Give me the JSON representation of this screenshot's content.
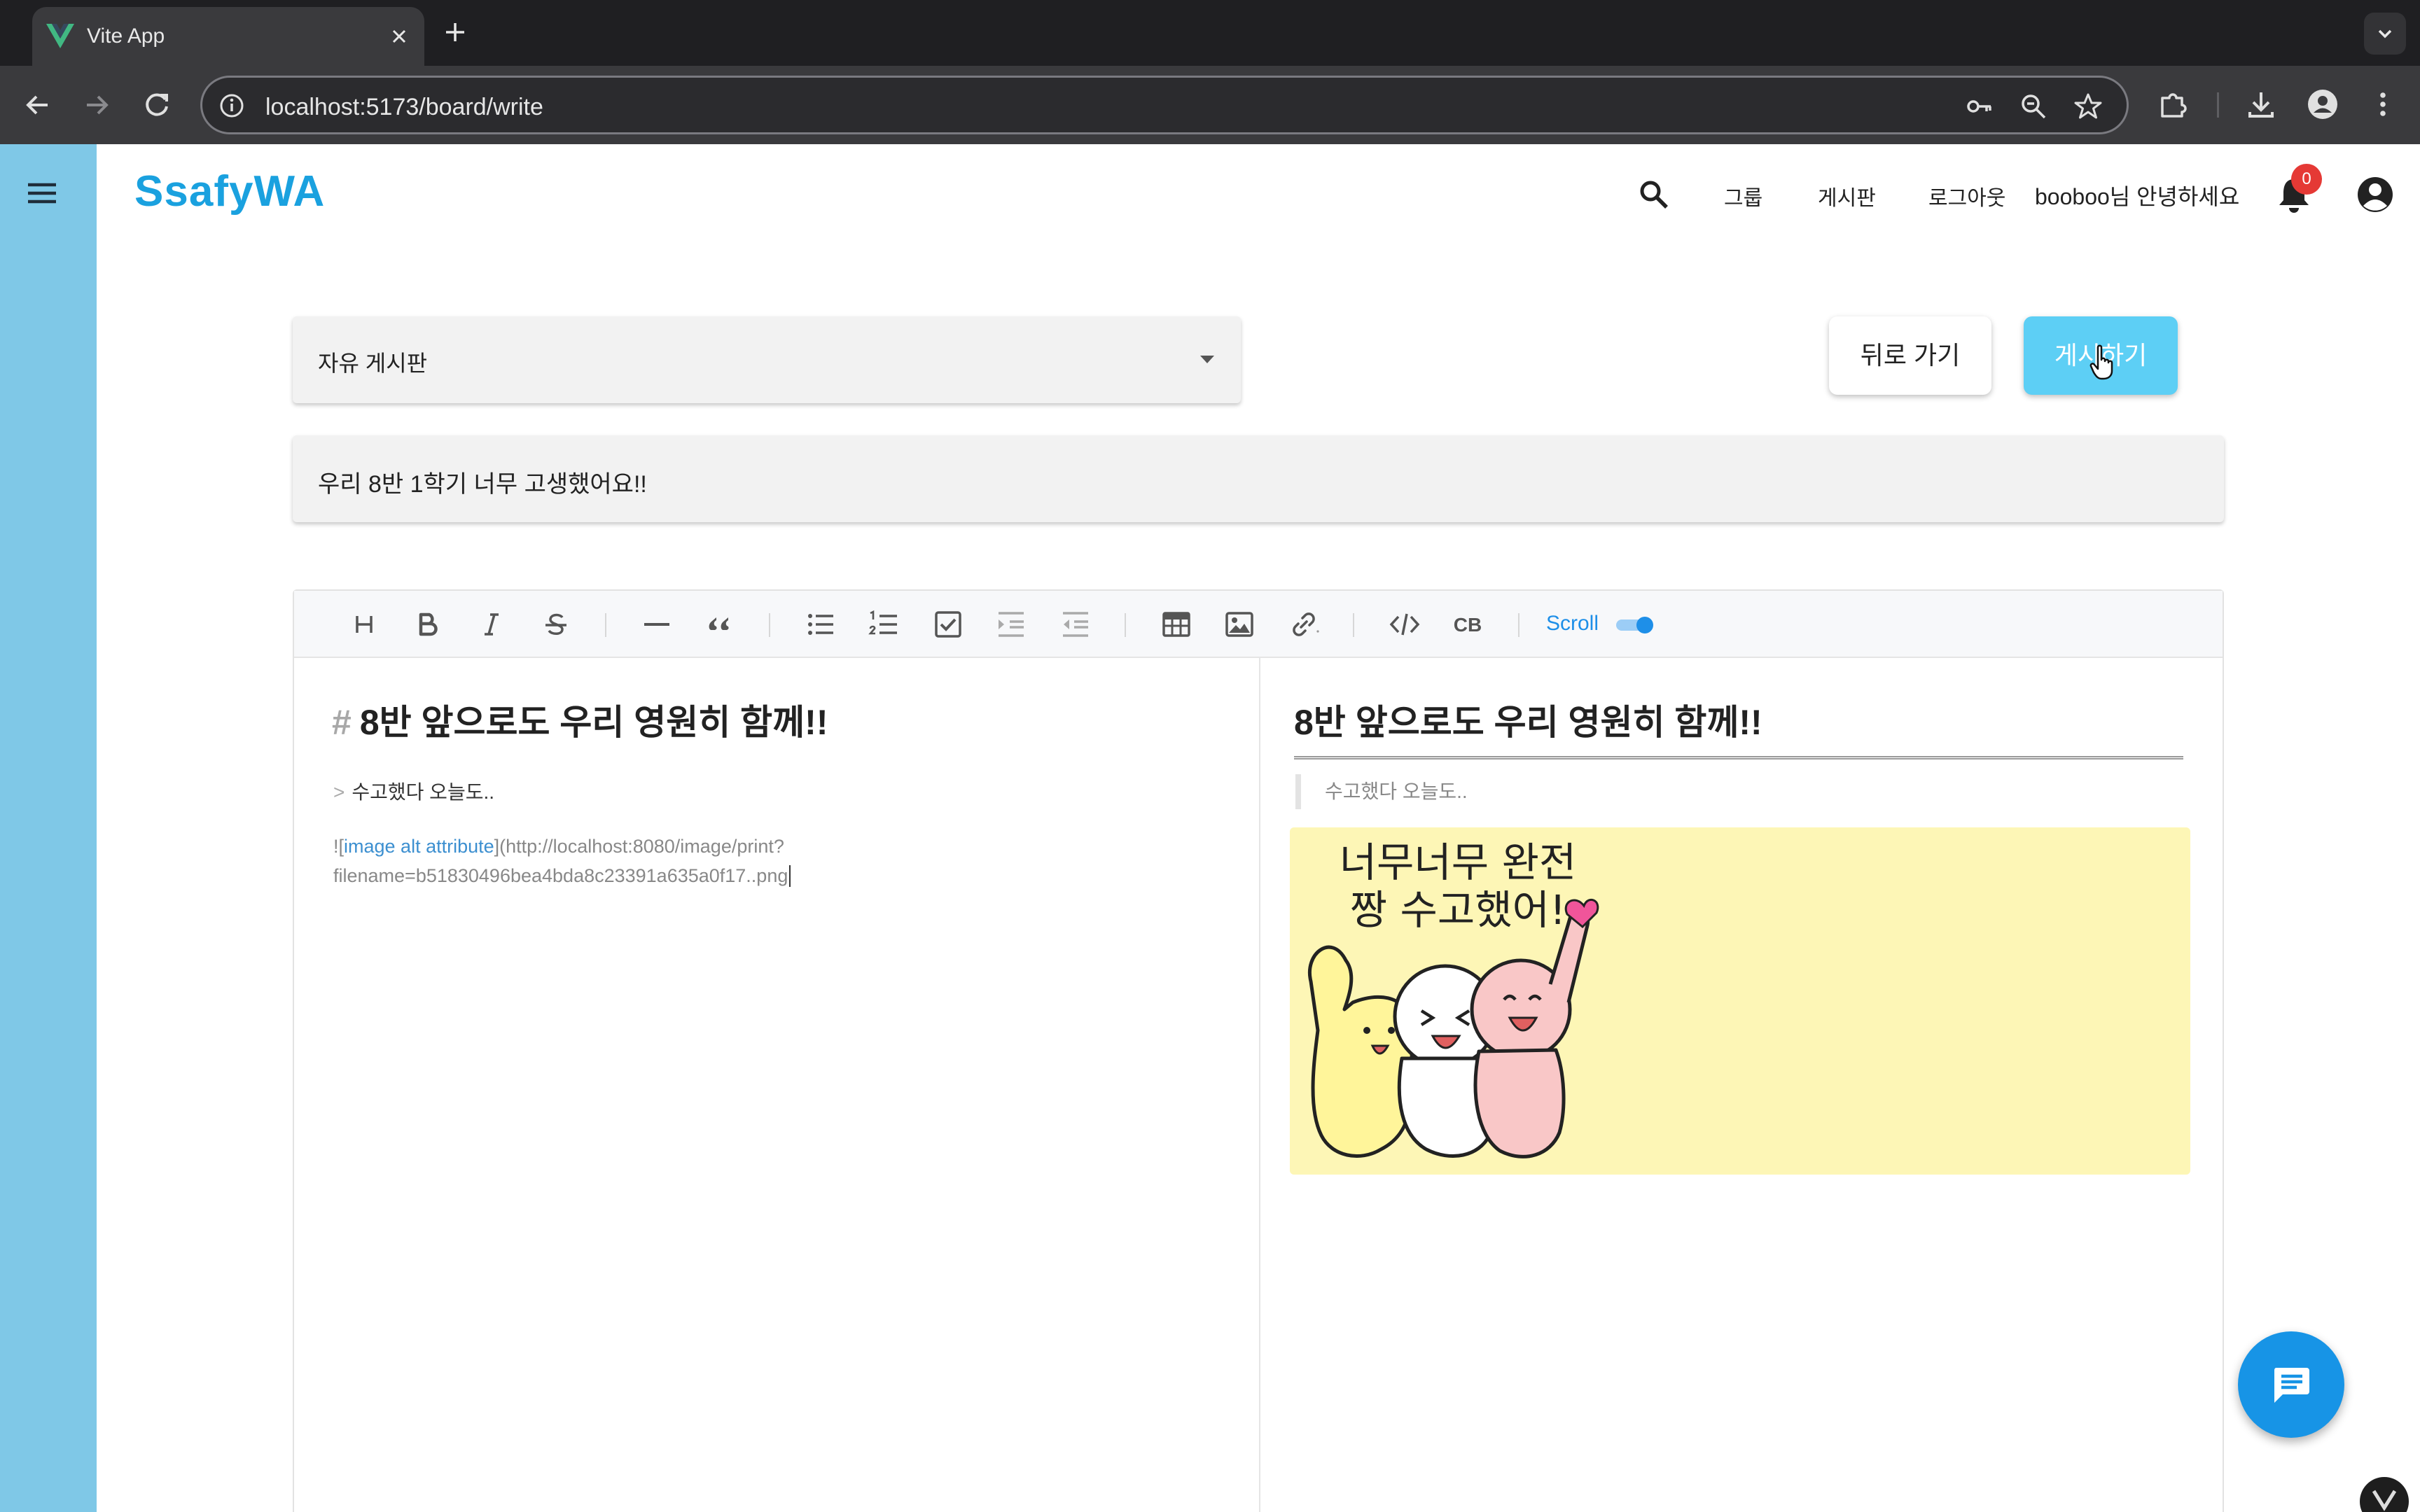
{
  "browser": {
    "tab_title": "Vite App",
    "url": "localhost:5173/board/write"
  },
  "app": {
    "brand": "SsafyWA",
    "nav": {
      "group": "그룹",
      "board": "게시판",
      "logout": "로그아웃",
      "greeting": "booboo님 안녕하세요",
      "notification_count": "0"
    }
  },
  "form": {
    "board_select": {
      "selected": "자유 게시판"
    },
    "back_button": "뒤로 가기",
    "post_button": "게시하기",
    "title_value": "우리 8반 1학기 너무 고생했어요!!"
  },
  "editor": {
    "toolbar": {
      "scroll_label": "Scroll",
      "scroll_sync_on": true,
      "codeblock_label": "CB"
    },
    "source": {
      "heading_mark": "#",
      "heading_text": "8반 앞으로도 우리 영원히 함께!!",
      "quote_mark": ">",
      "quote_text": "수고했다 오늘도..",
      "image_prefix": "![",
      "image_alt": "image alt attribute",
      "image_url_line1": "](http://localhost:8080/image/print?",
      "image_url_line2": "filename=b51830496bea4bda8c23391a635a0f17..png"
    },
    "preview": {
      "heading": "8반 앞으로도 우리 영원히 함께!!",
      "quote": "수고했다 오늘도..",
      "image_caption_line1": "너무너무 완전",
      "image_caption_line2": "짱 수고했어!"
    }
  },
  "colors": {
    "brand": "#1aa1df",
    "sidebar": "#7fc8e7",
    "post_button": "#5dcff5",
    "fab": "#1794e6",
    "badge": "#e53935"
  }
}
